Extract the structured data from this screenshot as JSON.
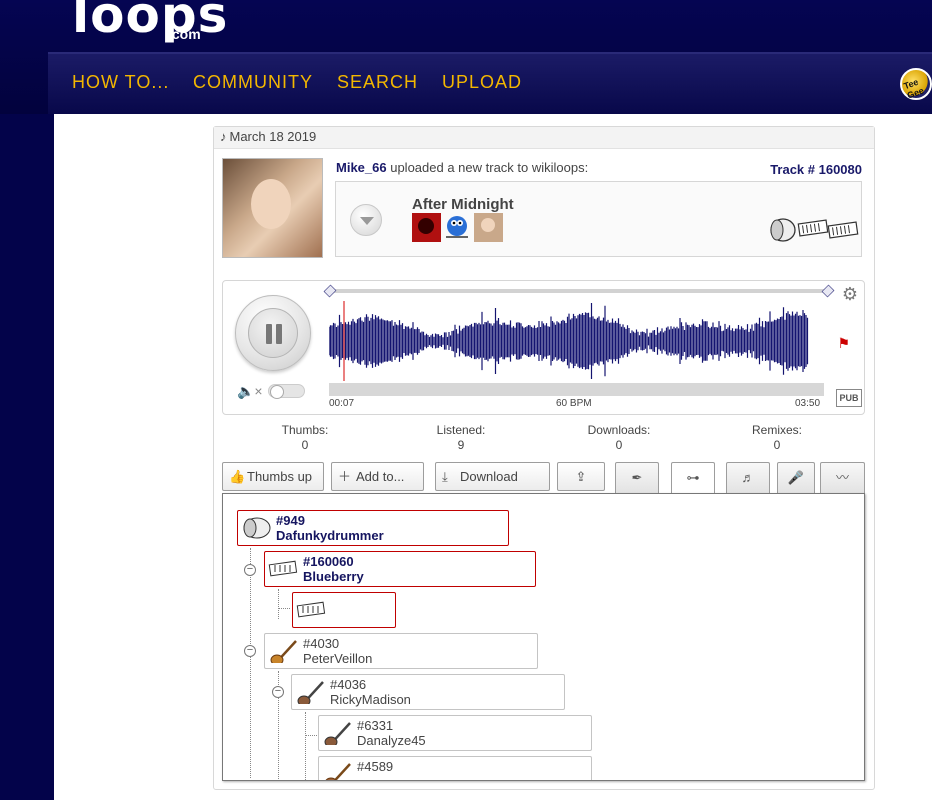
{
  "site": {
    "logo_text": "loops",
    "logo_suffix": ".com",
    "nav": [
      "HOW TO...",
      "COMMUNITY",
      "SEARCH",
      "UPLOAD"
    ],
    "user_badge": "Tee Gee"
  },
  "post": {
    "date": "March 18 2019",
    "uploader": "Mike_66",
    "upload_text": "uploaded a new track to wikiloops:",
    "track_number": "Track # 160080",
    "track_title": "After Midnight"
  },
  "player": {
    "time_start": "00:07",
    "bpm": "60 BPM",
    "time_end": "03:50",
    "pub_label": "PUB",
    "playhead_fraction": 0.03,
    "loop_start_fraction": 0.0,
    "loop_end_fraction": 1.0
  },
  "stats": [
    {
      "label": "Thumbs:",
      "value": "0"
    },
    {
      "label": "Listened:",
      "value": "9"
    },
    {
      "label": "Downloads:",
      "value": "0"
    },
    {
      "label": "Remixes:",
      "value": "0"
    }
  ],
  "actions": {
    "thumbs_up": "Thumbs up",
    "add_to": "Add to...",
    "download": "Download"
  },
  "tree": [
    {
      "id": "#949",
      "name": "Dafunkydrummer",
      "instrument": "drum-icon",
      "highlight": true
    },
    {
      "id": "#160060",
      "name": "Blueberry",
      "instrument": "keyboard-icon",
      "highlight": true
    },
    {
      "id": "",
      "name": "",
      "instrument": "keyboard-icon",
      "highlight": true
    },
    {
      "id": "#4030",
      "name": "PeterVeillon",
      "instrument": "bass-guitar-icon",
      "highlight": false
    },
    {
      "id": "#4036",
      "name": "RickyMadison",
      "instrument": "electric-guitar-icon",
      "highlight": false
    },
    {
      "id": "#6331",
      "name": "Danalyze45",
      "instrument": "electric-guitar-icon",
      "highlight": false
    },
    {
      "id": "#4589",
      "name": "",
      "instrument": "guitar-icon",
      "highlight": false
    }
  ],
  "colors": {
    "nav_text": "#f3b700",
    "background": "#03034a",
    "waveform": "#141470",
    "highlight_border": "#c00000"
  }
}
